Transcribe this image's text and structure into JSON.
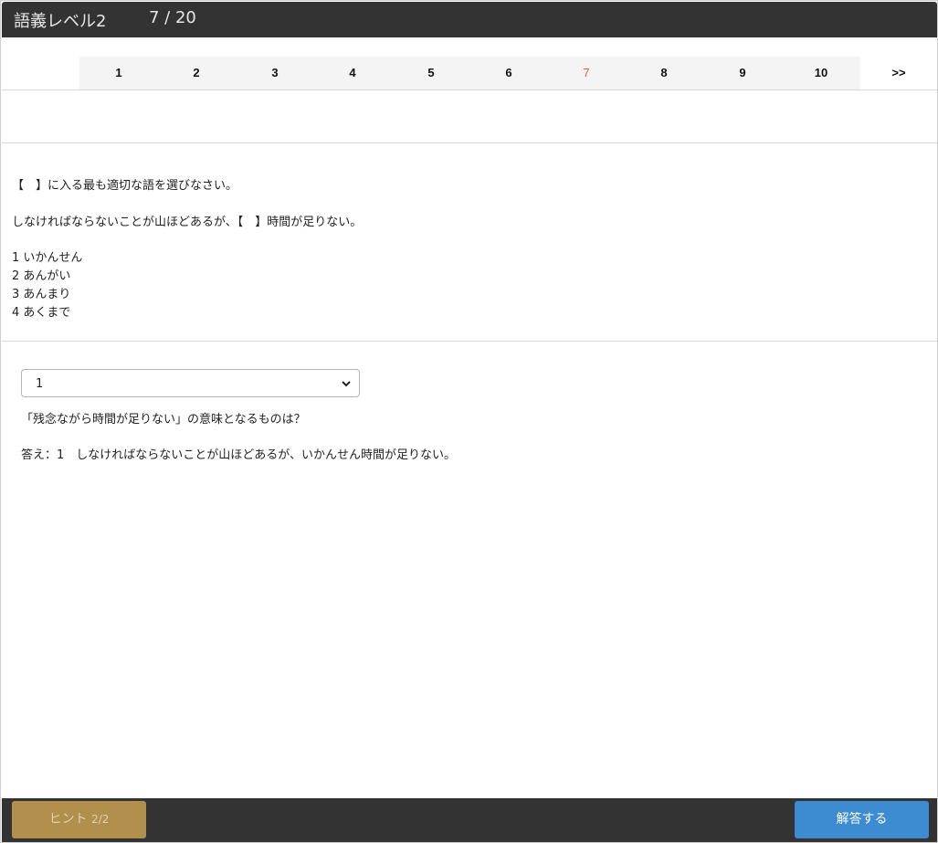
{
  "header": {
    "title": "語義レベル2",
    "progress": "7 / 20"
  },
  "pager": {
    "pages": [
      "1",
      "2",
      "3",
      "4",
      "5",
      "6",
      "7",
      "8",
      "9",
      "10"
    ],
    "active_index": 6,
    "next_label": ">>"
  },
  "question": {
    "instruction": "【　】に入る最も適切な語を選びなさい。",
    "sentence": "しなければならないことが山ほどあるが、【　】時間が足りない。",
    "options": [
      "1 いかんせん",
      "2 あんがい",
      "3 あんまり",
      "4 あくまで"
    ]
  },
  "answer_select": {
    "value": "1"
  },
  "hint_text": "「残念ながら時間が足りない」の意味となるものは？",
  "answer_text": "答え：1　しなければならないことが山ほどあるが、いかんせん時間が足りない。",
  "footer": {
    "hint_label": "ヒント",
    "hint_count": "2/2",
    "submit_label": "解答する"
  },
  "colors": {
    "header_bg": "#333333",
    "active_page": "#e8622a",
    "hint_btn": "#b38f4d",
    "submit_btn": "#3d8bd0"
  },
  "icons": {
    "select_chevron": "chevron-down-icon"
  }
}
